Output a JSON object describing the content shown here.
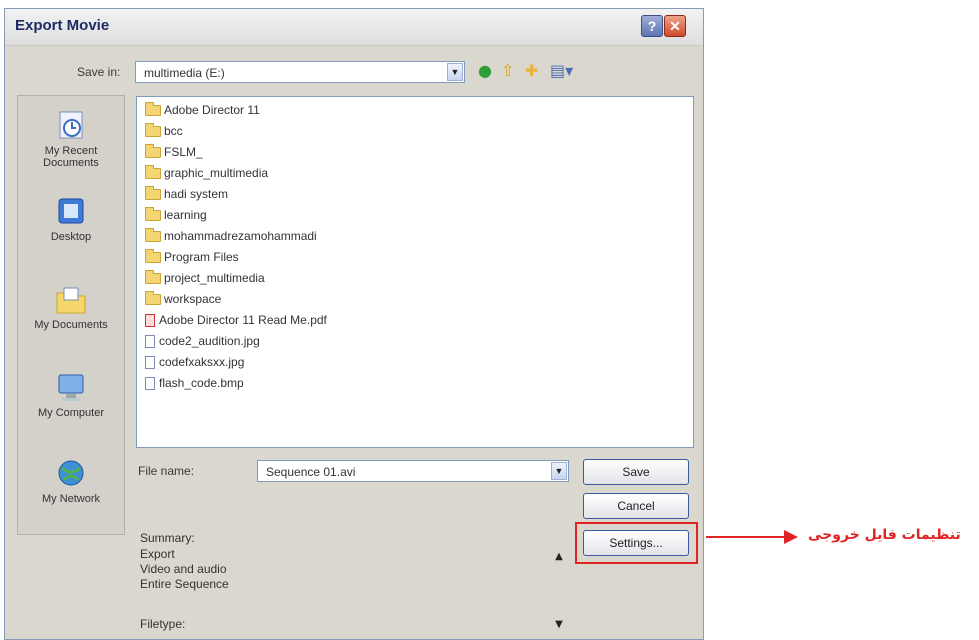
{
  "window": {
    "title": "Export Movie",
    "help_label": "?",
    "close_label": "✕"
  },
  "save_in": {
    "label": "Save in:",
    "value": "multimedia (E:)"
  },
  "places": [
    {
      "label": "My Recent Documents"
    },
    {
      "label": "Desktop"
    },
    {
      "label": "My Documents"
    },
    {
      "label": "My Computer"
    },
    {
      "label": "My Network"
    }
  ],
  "files": [
    {
      "name": "Adobe Director 11",
      "type": "folder"
    },
    {
      "name": "bcc",
      "type": "folder"
    },
    {
      "name": "FSLM_",
      "type": "folder"
    },
    {
      "name": "graphic_multimedia",
      "type": "folder"
    },
    {
      "name": "hadi system",
      "type": "folder"
    },
    {
      "name": "learning",
      "type": "folder"
    },
    {
      "name": "mohammadrezamohammadi",
      "type": "folder"
    },
    {
      "name": "Program Files",
      "type": "folder"
    },
    {
      "name": "project_multimedia",
      "type": "folder"
    },
    {
      "name": "workspace",
      "type": "folder"
    },
    {
      "name": "Adobe Director 11 Read Me.pdf",
      "type": "pdf"
    },
    {
      "name": "code2_audition.jpg",
      "type": "file"
    },
    {
      "name": "codefxaksxx.jpg",
      "type": "file"
    },
    {
      "name": "flash_code.bmp",
      "type": "file"
    }
  ],
  "filename": {
    "label": "File name:",
    "value": "Sequence 01.avi"
  },
  "buttons": {
    "save": "Save",
    "cancel": "Cancel",
    "settings": "Settings..."
  },
  "summary": {
    "label": "Summary:",
    "lines": [
      "Export",
      "Video and audio",
      "Entire Sequence"
    ],
    "filetype_label": "Filetype:"
  },
  "annotation": {
    "text": "تنظیمات فایل خروجی",
    "color": "#e02424"
  }
}
